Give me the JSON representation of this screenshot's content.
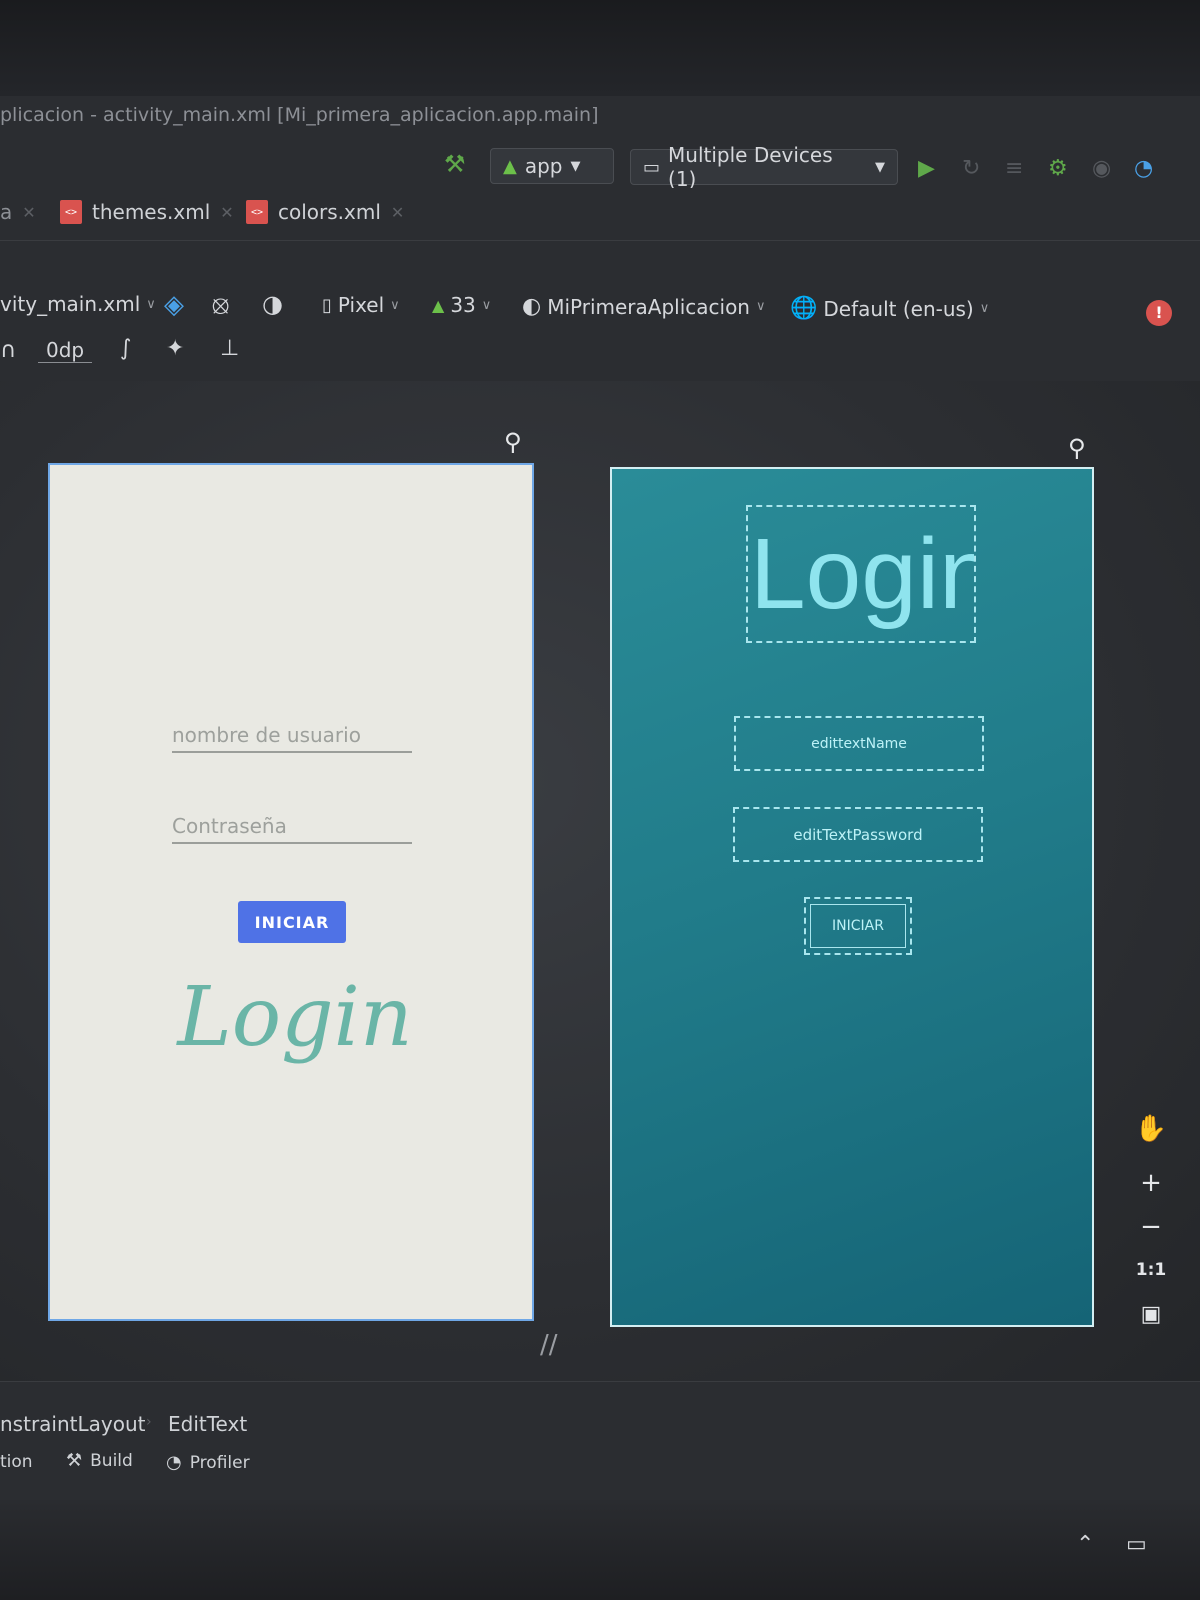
{
  "window": {
    "title": "plicacion - activity_main.xml [Mi_primera_aplicacion.app.main]"
  },
  "toolbar": {
    "run_config": "app",
    "device": "Multiple Devices (1)"
  },
  "tabs": [
    {
      "label": "themes.xml"
    },
    {
      "label": "colors.xml"
    }
  ],
  "design_toolbar": {
    "file": "vity_main.xml",
    "device": "Pixel",
    "api": "33",
    "theme": "MiPrimeraAplicacion",
    "locale": "Default (en-us)",
    "margin": "0dp"
  },
  "design_preview": {
    "title": "Login",
    "username_hint": "nombre de usuario",
    "password_hint": "Contraseña",
    "button_label": "INICIAR"
  },
  "blueprint": {
    "title": "Login",
    "name_field_id": "edittextName",
    "password_field_id": "editTextPassword",
    "button_label": "INICIAR"
  },
  "zoom_controls": {
    "zoom_in": "+",
    "zoom_out": "−",
    "actual_size": "1:1"
  },
  "bottom": {
    "breadcrumb_parent": "nstraintLayout",
    "breadcrumb_child": "EditText",
    "tool_windows": [
      {
        "label": "tion"
      },
      {
        "label": "Build"
      },
      {
        "label": "Profiler"
      }
    ]
  },
  "colors": {
    "accent_button": "#4f72e6",
    "login_script": "#6ab5a7",
    "blueprint_bg": "#217c8a"
  }
}
